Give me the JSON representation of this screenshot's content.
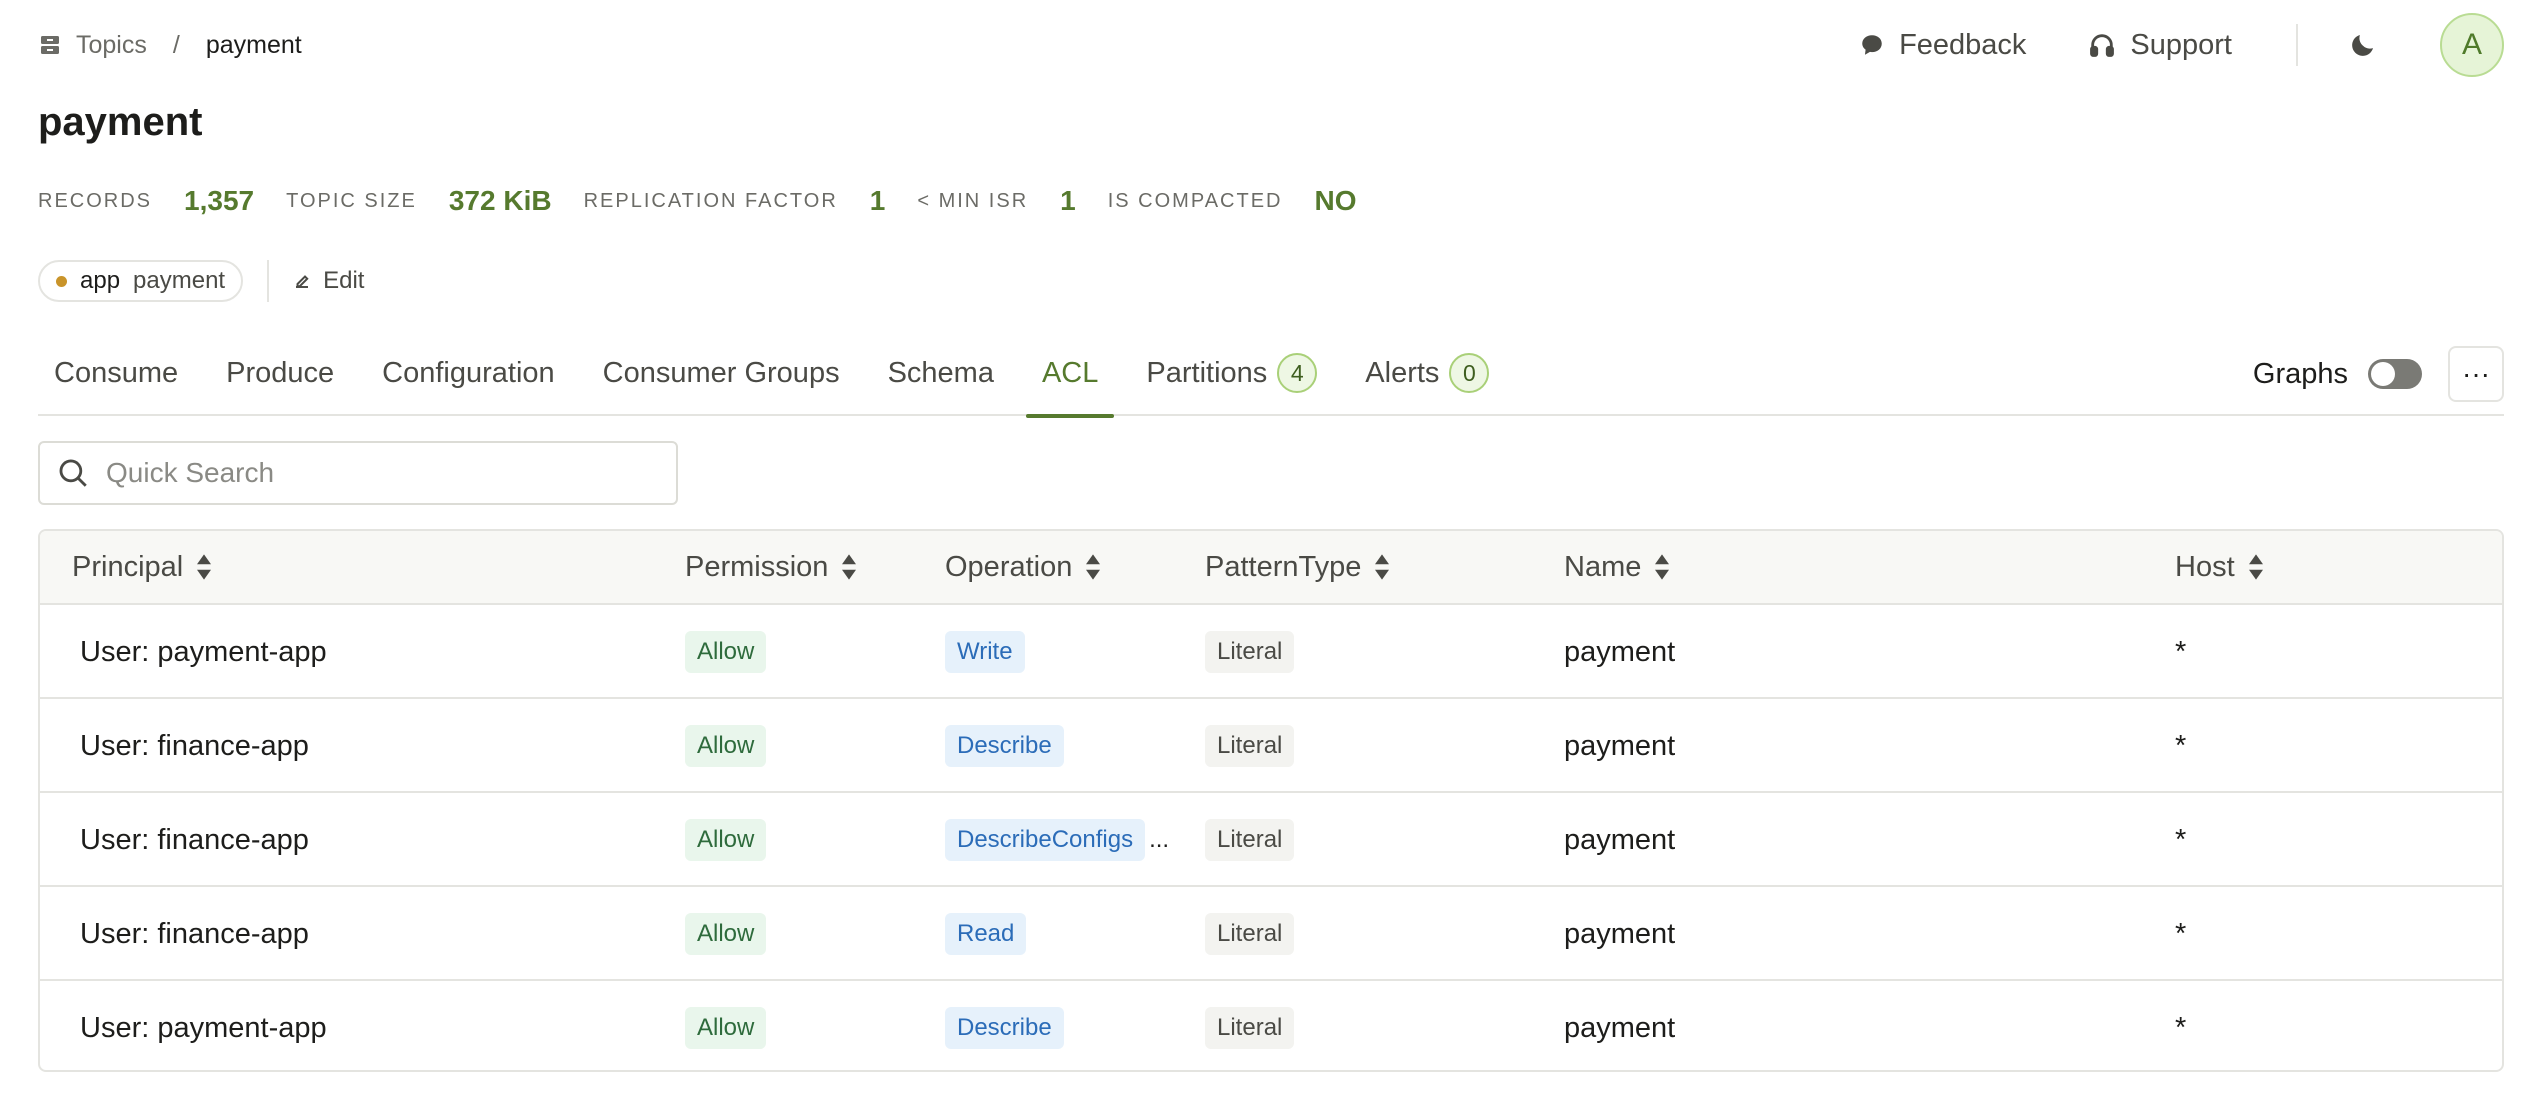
{
  "breadcrumb": {
    "root": "Topics",
    "separator": "/",
    "current": "payment"
  },
  "header": {
    "feedback": "Feedback",
    "support": "Support",
    "avatar_initial": "A"
  },
  "page_title": "payment",
  "stats": [
    {
      "label": "RECORDS",
      "value": "1,357"
    },
    {
      "label": "TOPIC SIZE",
      "value": "372 KiB"
    },
    {
      "label": "REPLICATION FACTOR",
      "value": "1"
    },
    {
      "label": "< MIN ISR",
      "value": "1"
    },
    {
      "label": "IS COMPACTED",
      "value": "NO"
    }
  ],
  "label_tag": {
    "key": "app",
    "value": "payment"
  },
  "edit_label": "Edit",
  "tabs": [
    {
      "label": "Consume"
    },
    {
      "label": "Produce"
    },
    {
      "label": "Configuration"
    },
    {
      "label": "Consumer Groups"
    },
    {
      "label": "Schema"
    },
    {
      "label": "ACL",
      "active": true
    },
    {
      "label": "Partitions",
      "badge": "4"
    },
    {
      "label": "Alerts",
      "badge": "0"
    }
  ],
  "graphs_label": "Graphs",
  "more_label": "···",
  "search": {
    "placeholder": "Quick Search"
  },
  "table": {
    "columns": [
      "Principal",
      "Permission",
      "Operation",
      "PatternType",
      "Name",
      "Host"
    ],
    "rows": [
      {
        "principal": "User: payment-app",
        "permission": "Allow",
        "operation": "Write",
        "pattern": "Literal",
        "name": "payment",
        "host": "*"
      },
      {
        "principal": "User: finance-app",
        "permission": "Allow",
        "operation": "Describe",
        "pattern": "Literal",
        "name": "payment",
        "host": "*"
      },
      {
        "principal": "User: finance-app",
        "permission": "Allow",
        "operation": "DescribeConfigs",
        "operation_truncated": "...",
        "pattern": "Literal",
        "name": "payment",
        "host": "*"
      },
      {
        "principal": "User: finance-app",
        "permission": "Allow",
        "operation": "Read",
        "pattern": "Literal",
        "name": "payment",
        "host": "*"
      },
      {
        "principal": "User: payment-app",
        "permission": "Allow",
        "operation": "Describe",
        "pattern": "Literal",
        "name": "payment",
        "host": "*"
      }
    ]
  }
}
